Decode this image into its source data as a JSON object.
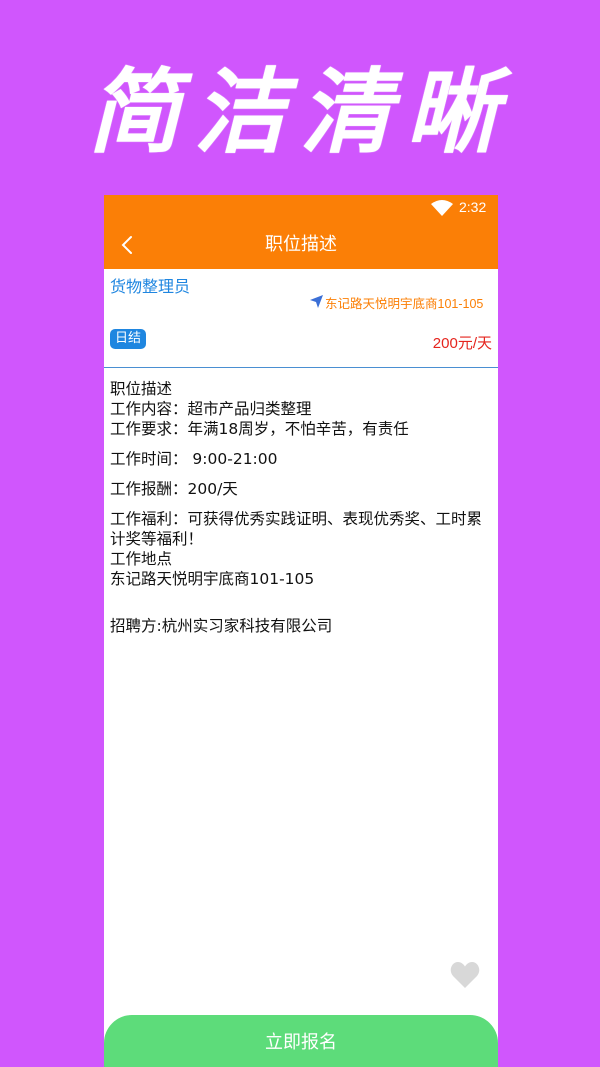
{
  "banner": {
    "title": "简洁清晰"
  },
  "status": {
    "time": "2:32"
  },
  "appbar": {
    "title": "职位描述"
  },
  "job": {
    "name": "货物整理员",
    "address": "东记路天悦明宇底商101-105",
    "pay_type": "日结",
    "salary": "200元/天"
  },
  "description": {
    "heading": "职位描述",
    "content": "工作内容：超市产品归类整理",
    "requirement": "工作要求：年满18周岁，不怕辛苦，有责任",
    "time": "工作时间： 9:00-21:00",
    "pay": "工作报酬：200/天",
    "welfare": "工作福利：可获得优秀实践证明、表现优秀奖、工时累计奖等福利！",
    "place_label": "工作地点",
    "place": "东记路天悦明宇底商101-105",
    "employer": "招聘方:杭州实习家科技有限公司"
  },
  "actions": {
    "apply_label": "立即报名"
  },
  "colors": {
    "background": "#d056fd",
    "header": "#fb7f06",
    "accent_blue": "#1f86e0",
    "salary_red": "#e5241d",
    "button_green": "#5ddc7a"
  },
  "icons": [
    "wifi-icon",
    "back-icon",
    "location-icon",
    "heart-icon"
  ]
}
